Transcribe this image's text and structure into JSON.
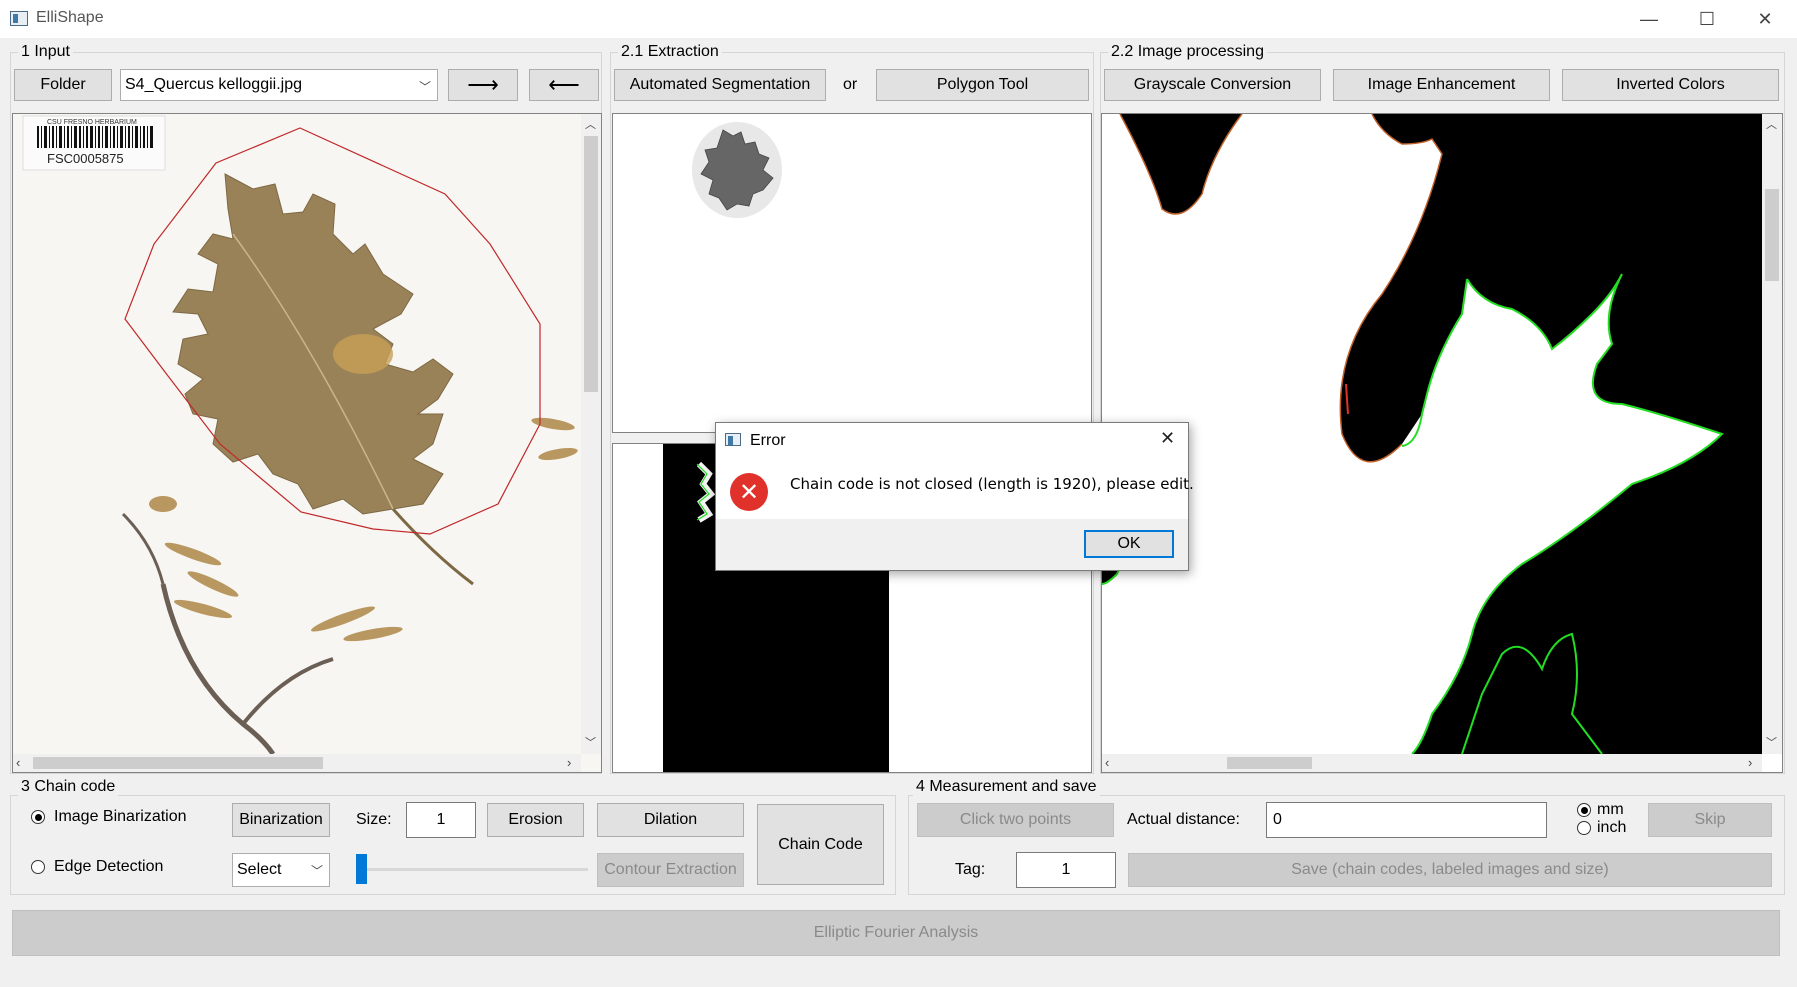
{
  "window": {
    "title": "ElliShape",
    "minimize": "—",
    "maximize": "☐",
    "close": "✕"
  },
  "input": {
    "group_label": "1 Input",
    "folder_button": "Folder",
    "file_select": "S4_Quercus kelloggii.jpg",
    "next_button": "⟶",
    "prev_button": "⟵",
    "barcode_header": "CSU FRESNO HERBARIUM",
    "barcode_id": "FSC0005875"
  },
  "extraction": {
    "group_label": "2.1 Extraction",
    "auto_seg_button": "Automated Segmentation",
    "or_label": "or",
    "polygon_button": "Polygon Tool"
  },
  "processing": {
    "group_label": "2.2 Image processing",
    "grayscale_button": "Grayscale Conversion",
    "enhance_button": "Image Enhancement",
    "invert_button": "Inverted Colors"
  },
  "chain": {
    "group_label": "3 Chain code",
    "binarization_radio": "Image Binarization",
    "edge_radio": "Edge Detection",
    "binarization_button": "Binarization",
    "size_label": "Size:",
    "size_value": "1",
    "erosion_button": "Erosion",
    "dilation_button": "Dilation",
    "edge_select": "Select",
    "contour_button": "Contour Extraction",
    "chain_button": "Chain Code"
  },
  "measure": {
    "group_label": "4 Measurement and save",
    "click_points_button": "Click two points",
    "distance_label": "Actual distance:",
    "distance_value": "0",
    "unit_mm": "mm",
    "unit_inch": "inch",
    "skip_button": "Skip",
    "tag_label": "Tag:",
    "tag_value": "1",
    "save_button": "Save (chain codes, labeled images and size)"
  },
  "efa_button": "Elliptic Fourier Analysis",
  "dialog": {
    "title": "Error",
    "message": "Chain code is not closed (length is 1920), please edit.",
    "ok_button": "OK"
  },
  "colors": {
    "polygon": "#c0282a",
    "contour": "#22dd22",
    "leaf": "#9a8258",
    "error": "#e0312a"
  }
}
